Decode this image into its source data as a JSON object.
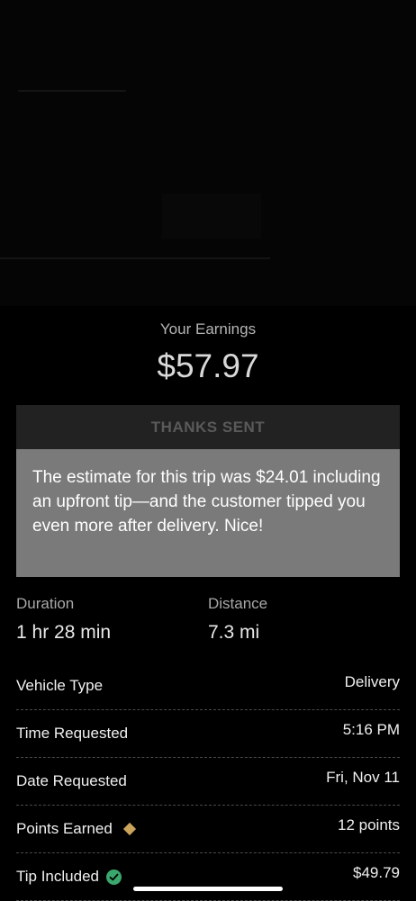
{
  "earnings": {
    "label": "Your Earnings",
    "amount": "$57.97"
  },
  "thanks_button": {
    "label": "THANKS SENT"
  },
  "estimate_message": "The estimate for this trip was $24.01 including an upfront tip—and the customer tipped you even more after delivery. Nice!",
  "stats": {
    "duration": {
      "label": "Duration",
      "value": "1 hr 28 min"
    },
    "distance": {
      "label": "Distance",
      "value": "7.3 mi"
    }
  },
  "details": [
    {
      "label": "Vehicle Type",
      "value": "Delivery",
      "icon": ""
    },
    {
      "label": "Time Requested",
      "value": "5:16 PM",
      "icon": ""
    },
    {
      "label": "Date Requested",
      "value": "Fri, Nov 11",
      "icon": ""
    },
    {
      "label": "Points Earned",
      "value": "12 points",
      "icon": "diamond-icon"
    },
    {
      "label": "Tip Included",
      "value": "$49.79",
      "icon": "check-circle-icon"
    }
  ],
  "colors": {
    "background": "#000000",
    "estimate_box": "#7a7a7a",
    "button_bg": "#222222",
    "diamond": "#c9a45a",
    "check": "#3aa76d"
  }
}
